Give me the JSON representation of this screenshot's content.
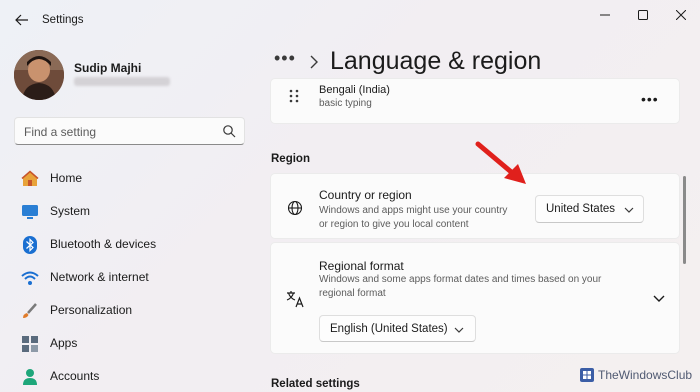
{
  "window": {
    "title": "Settings"
  },
  "profile": {
    "name": "Sudip Majhi"
  },
  "search": {
    "placeholder": "Find a setting"
  },
  "nav": {
    "items": [
      {
        "label": "Home",
        "icon": "home-icon"
      },
      {
        "label": "System",
        "icon": "system-icon"
      },
      {
        "label": "Bluetooth & devices",
        "icon": "bluetooth-icon"
      },
      {
        "label": "Network & internet",
        "icon": "wifi-icon"
      },
      {
        "label": "Personalization",
        "icon": "brush-icon"
      },
      {
        "label": "Apps",
        "icon": "apps-icon"
      },
      {
        "label": "Accounts",
        "icon": "accounts-icon"
      }
    ]
  },
  "header": {
    "breadcrumb_more": "•••",
    "title": "Language & region"
  },
  "language_card": {
    "name": "Bengali (India)",
    "sub": "basic typing",
    "more": "•••"
  },
  "region": {
    "section_label": "Region",
    "country": {
      "title": "Country or region",
      "desc_line1": "Windows and apps might use your country",
      "desc_line2": "or region to give you local content",
      "value": "United States"
    },
    "format": {
      "title": "Regional format",
      "desc_line1": "Windows and some apps format dates and times based on your",
      "desc_line2": "regional format",
      "value": "English (United States)"
    }
  },
  "related": {
    "section_label": "Related settings"
  },
  "watermark": {
    "text": "TheWindowsClub"
  },
  "colors": {
    "accent": "#0067c0",
    "arrow": "#e0201c"
  }
}
